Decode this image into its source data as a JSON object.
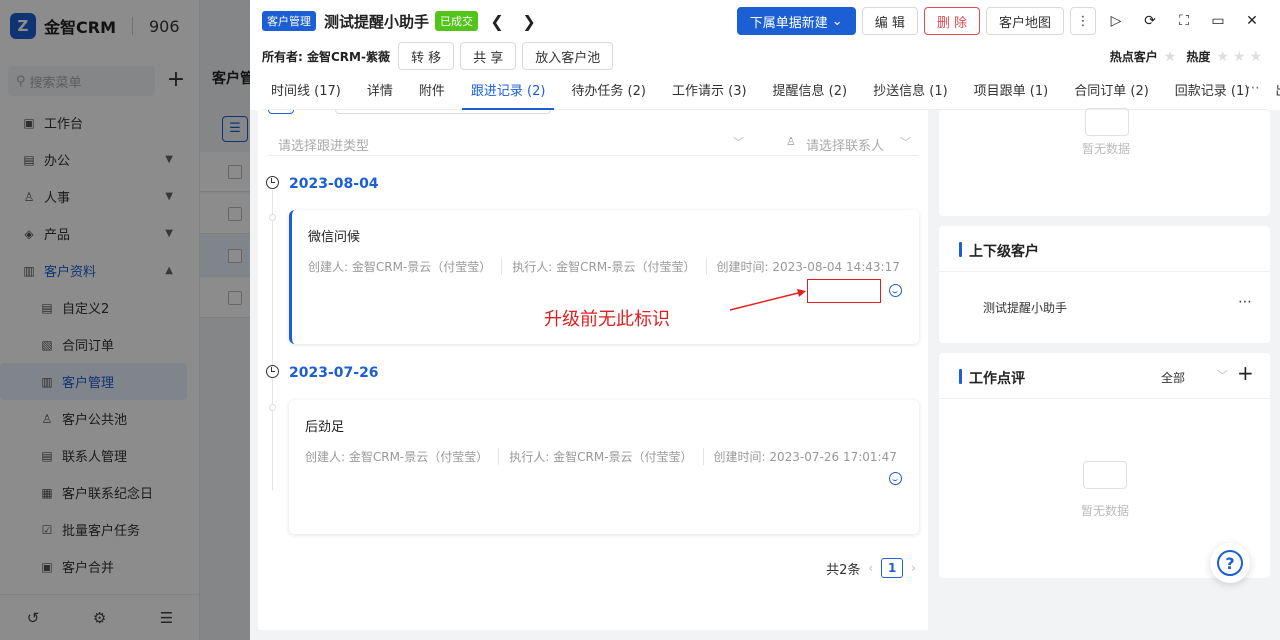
{
  "app": {
    "logo": "Z",
    "name": "金智CRM",
    "num": "906",
    "search_placeholder": "搜索菜单",
    "menu": [
      {
        "label": "工作台",
        "icon": "▣"
      },
      {
        "label": "办公",
        "icon": "▤"
      },
      {
        "label": "人事",
        "icon": "♙"
      },
      {
        "label": "产品",
        "icon": "◈"
      },
      {
        "label": "客户资料",
        "icon": "▥"
      }
    ],
    "submenu": [
      {
        "label": "自定义2"
      },
      {
        "label": "合同订单"
      },
      {
        "label": "客户管理"
      },
      {
        "label": "客户公共池"
      },
      {
        "label": "联系人管理"
      },
      {
        "label": "客户联系纪念日"
      },
      {
        "label": "批量客户任务"
      },
      {
        "label": "客户合并"
      }
    ],
    "bg_title": "客户管"
  },
  "drawer": {
    "module_tag": "客户管理",
    "customer_name": "测试提醒小助手",
    "status_tag": "已成交",
    "actions": {
      "new_sub": "下属单据新建",
      "edit": "编 辑",
      "delete": "删 除",
      "map": "客户地图"
    },
    "owner_label": "所有者: 金智CRM-紫薇",
    "owner_buttons": {
      "transfer": "转 移",
      "share": "共 享",
      "to_pool": "放入客户池"
    },
    "hot_label": "热点客户",
    "heat_label": "热度",
    "tabs": [
      {
        "label": "时间线 (17)"
      },
      {
        "label": "详情"
      },
      {
        "label": "附件"
      },
      {
        "label": "跟进记录 (2)"
      },
      {
        "label": "待办任务 (2)"
      },
      {
        "label": "工作请示 (3)"
      },
      {
        "label": "提醒信息 (2)"
      },
      {
        "label": "抄送信息 (1)"
      },
      {
        "label": "项目跟单 (1)"
      },
      {
        "label": "合同订单 (2)"
      },
      {
        "label": "回款记录 (1)"
      },
      {
        "label": "出库单 ("
      }
    ],
    "filters": {
      "type_placeholder": "请选择跟进类型",
      "contact_placeholder": "请选择联系人"
    },
    "records": [
      {
        "date": "2023-08-04",
        "title": "微信问候",
        "creator": "创建人: 金智CRM-景云（付莹莹）",
        "executor": "执行人: 金智CRM-景云（付莹莹）",
        "created": "创建时间: 2023-08-04 14:43:17"
      },
      {
        "date": "2023-07-26",
        "title": "后劲足",
        "creator": "创建人: 金智CRM-景云（付莹莹）",
        "executor": "执行人: 金智CRM-景云（付莹莹）",
        "created": "创建时间: 2023-07-26 17:01:47"
      }
    ],
    "annotation": "升级前无此标识",
    "pagination": {
      "total": "共2条",
      "current": "1"
    },
    "panels": {
      "empty_text": "暂无数据",
      "hierarchy_title": "上下级客户",
      "hierarchy_item": "测试提醒小助手",
      "review_title": "工作点评",
      "review_filter": "全部"
    },
    "help": "?"
  }
}
